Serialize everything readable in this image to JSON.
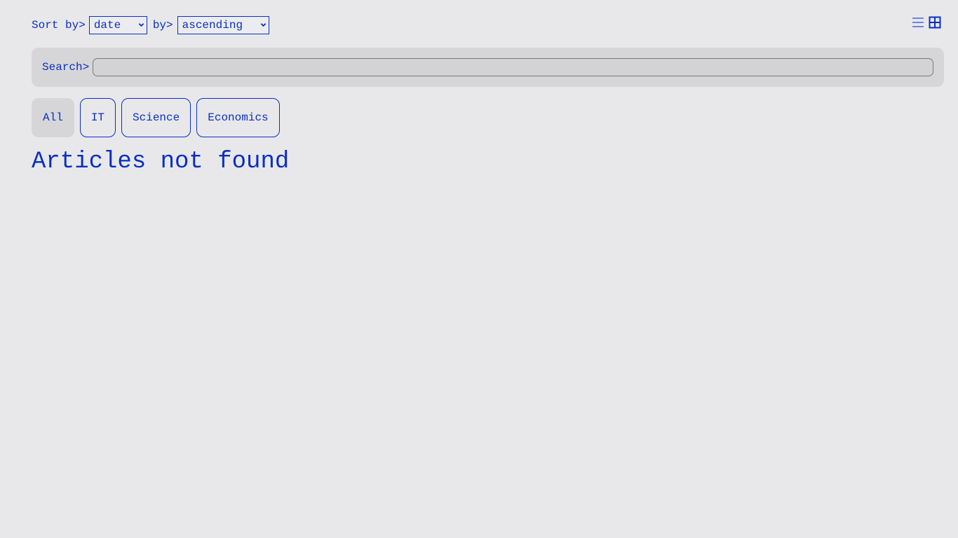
{
  "toolbar": {
    "sort_label": "Sort by>",
    "sort_value": "date",
    "order_label": "by>",
    "order_value": "ascending"
  },
  "view_toggle": {
    "list_icon": "list-view-icon",
    "grid_icon": "grid-view-icon",
    "active": "grid"
  },
  "search": {
    "label": "Search>",
    "value": "",
    "placeholder": ""
  },
  "filters": {
    "items": [
      {
        "label": "All",
        "active": true
      },
      {
        "label": "IT",
        "active": false
      },
      {
        "label": "Science",
        "active": false
      },
      {
        "label": "Economics",
        "active": false
      }
    ]
  },
  "main": {
    "message": "Articles not found"
  },
  "colors": {
    "accent": "#0a2fbf",
    "background": "#e8e8eb",
    "panel": "#d6d6d9"
  }
}
